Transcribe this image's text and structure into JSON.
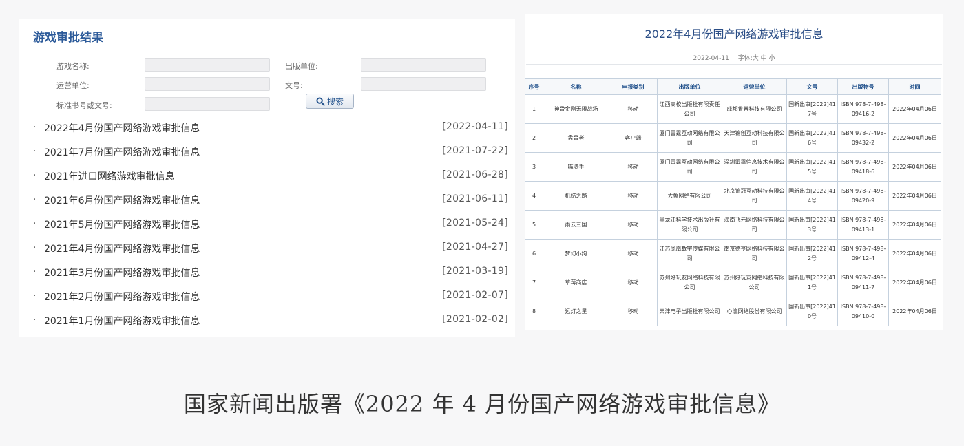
{
  "left": {
    "title": "游戏审批结果",
    "form": {
      "game_name_label": "游戏名称:",
      "publisher_label": "出版单位:",
      "operator_label": "运营单位:",
      "doc_no_label": "文号:",
      "isbn_label": "标准书号或文号:",
      "search_label": "搜索"
    },
    "notices": [
      {
        "title": "2022年4月份国产网络游戏审批信息",
        "date": "[2022-04-11]"
      },
      {
        "title": "2021年7月份国产网络游戏审批信息",
        "date": "[2021-07-22]"
      },
      {
        "title": "2021年进口网络游戏审批信息",
        "date": "[2021-06-28]"
      },
      {
        "title": "2021年6月份国产网络游戏审批信息",
        "date": "[2021-06-11]"
      },
      {
        "title": "2021年5月份国产网络游戏审批信息",
        "date": "[2021-05-24]"
      },
      {
        "title": "2021年4月份国产网络游戏审批信息",
        "date": "[2021-04-27]"
      },
      {
        "title": "2021年3月份国产网络游戏审批信息",
        "date": "[2021-03-19]"
      },
      {
        "title": "2021年2月份国产网络游戏审批信息",
        "date": "[2021-02-07]"
      },
      {
        "title": "2021年1月份国产网络游戏审批信息",
        "date": "[2021-02-02]"
      }
    ]
  },
  "right": {
    "title": "2022年4月份国产网络游戏审批信息",
    "meta_date": "2022-04-11",
    "meta_font": "字体:大 中 小",
    "headers": [
      "序号",
      "名称",
      "申报类别",
      "出版单位",
      "运营单位",
      "文号",
      "出版物号",
      "时间"
    ],
    "rows": [
      [
        "1",
        "神骨金刚无限战场",
        "移动",
        "江西高校出版社有限责任公司",
        "成都鲁普科技有限公司",
        "国新出审[2022]417号",
        "ISBN 978-7-498-09416-2",
        "2022年04月06日"
      ],
      [
        "2",
        "盘骨者",
        "客户端",
        "厦门雷霆互动网络有限公司",
        "天津锦创互动科技有限公司",
        "国新出审[2022]416号",
        "ISBN 978-7-498-09432-2",
        "2022年04月06日"
      ],
      [
        "3",
        "喵骑手",
        "移动",
        "厦门雷霆互动网络有限公司",
        "深圳雷霆信息技术有限公司",
        "国新出审[2022]415号",
        "ISBN 978-7-498-09418-6",
        "2022年04月06日"
      ],
      [
        "4",
        "机结之路",
        "移动",
        "大象网络有限公司",
        "北京锦冠互动科技有限公司",
        "国新出审[2022]414号",
        "ISBN 978-7-498-09420-9",
        "2022年04月06日"
      ],
      [
        "5",
        "雨云三国",
        "移动",
        "黑龙江科学技术出版社有限公司",
        "海南飞元网络科技有限公司",
        "国新出审[2022]413号",
        "ISBN 978-7-498-09413-1",
        "2022年04月06日"
      ],
      [
        "6",
        "梦幻小狗",
        "移动",
        "江苏凤凰数字传媒有限公司",
        "南京德亨网络科技有限公司",
        "国新出审[2022]412号",
        "ISBN 978-7-498-09412-4",
        "2022年04月06日"
      ],
      [
        "7",
        "草莓商店",
        "移动",
        "苏州好玩友网络科技有限公司",
        "苏州好玩友网络科技有限公司",
        "国新出审[2022]411号",
        "ISBN 978-7-498-09411-7",
        "2022年04月06日"
      ],
      [
        "8",
        "远灯之星",
        "移动",
        "天津电子出版社有限公司",
        "心流网络股份有限公司",
        "国新出审[2022]410号",
        "ISBN 978-7-498-09410-0",
        "2022年04月06日"
      ]
    ]
  },
  "caption": "国家新闻出版署《2022 年 4 月份国产网络游戏审批信息》",
  "colors": {
    "title_blue": "#2d5b9a",
    "header_blue": "#1f4f8a",
    "border": "#c5d1de"
  }
}
